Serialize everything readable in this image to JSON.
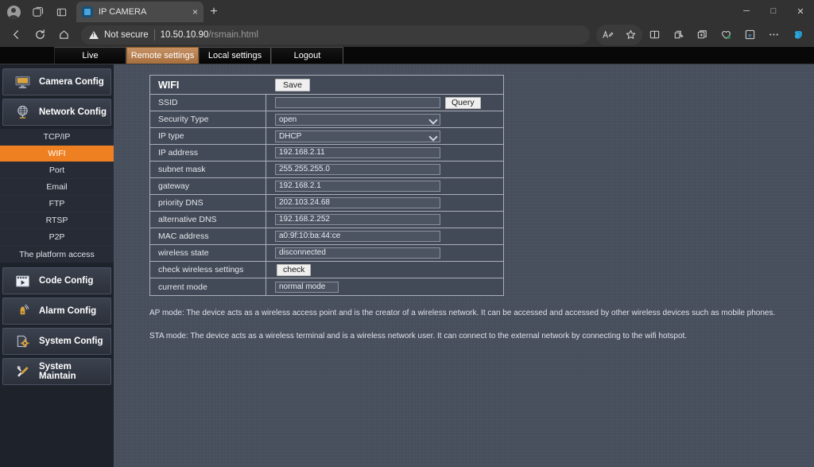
{
  "browser": {
    "tab": {
      "title": "IP CAMERA",
      "favicon": "camera-icon",
      "close": "×"
    },
    "newtab_label": "+",
    "window_controls": {
      "minimize": "─",
      "maximize": "□",
      "close": "✕"
    },
    "omnibox": {
      "security_label": "Not secure",
      "url_host": "10.50.10.90",
      "url_path": "/rsmain.html"
    },
    "toolbar_icons": [
      "read-aloud-icon",
      "favorite-star-icon",
      "split-screen-icon",
      "collections-icon",
      "tab-groups-icon",
      "browser-essentials-icon",
      "ie-mode-icon",
      "settings-more-icon",
      "copilot-icon"
    ],
    "nav_icons": [
      "back-icon",
      "refresh-icon",
      "home-icon"
    ]
  },
  "topnav": {
    "tabs": [
      {
        "label": "Live",
        "active": false
      },
      {
        "label": "Remote settings",
        "active": true
      },
      {
        "label": "Local settings",
        "active": false
      },
      {
        "label": "Logout",
        "active": false
      }
    ]
  },
  "sidebar": {
    "groups": [
      {
        "label": "Camera Config",
        "icon": "monitor-icon"
      },
      {
        "label": "Network Config",
        "icon": "globe-antenna-icon"
      }
    ],
    "sub_items": [
      {
        "label": "TCP/IP",
        "active": false
      },
      {
        "label": "WIFI",
        "active": true
      },
      {
        "label": "Port",
        "active": false
      },
      {
        "label": "Email",
        "active": false
      },
      {
        "label": "FTP",
        "active": false
      },
      {
        "label": "RTSP",
        "active": false
      },
      {
        "label": "P2P",
        "active": false
      },
      {
        "label": "The platform access",
        "active": false
      }
    ],
    "groups_lower": [
      {
        "label": "Code Config",
        "icon": "film-play-icon"
      },
      {
        "label": "Alarm Config",
        "icon": "alarm-bell-icon"
      },
      {
        "label": "System Config",
        "icon": "gear-document-icon"
      },
      {
        "label": "System Maintain",
        "icon": "wrench-screwdriver-icon"
      }
    ]
  },
  "panel": {
    "title": "WIFI",
    "save_label": "Save",
    "query_label": "Query",
    "check_label": "check",
    "rows": {
      "ssid": {
        "label": "SSID",
        "value": "",
        "placeholder": ""
      },
      "security_type": {
        "label": "Security Type",
        "value": "open"
      },
      "ip_type": {
        "label": "IP type",
        "value": "DHCP"
      },
      "ip_address": {
        "label": "IP address",
        "value": "192.168.2.11"
      },
      "subnet_mask": {
        "label": "subnet mask",
        "value": "255.255.255.0"
      },
      "gateway": {
        "label": "gateway",
        "value": "192.168.2.1"
      },
      "priority_dns": {
        "label": "priority DNS",
        "value": "202.103.24.68"
      },
      "alternative_dns": {
        "label": "alternative DNS",
        "value": "192.168.2.252"
      },
      "mac_address": {
        "label": "MAC address",
        "value": "a0:9f:10:ba:44:ce"
      },
      "wireless_state": {
        "label": "wireless state",
        "value": "disconnected"
      },
      "check_wireless": {
        "label": "check wireless settings"
      },
      "current_mode": {
        "label": "current mode",
        "value": "normal mode"
      }
    }
  },
  "help": {
    "ap_mode": "AP mode: The device acts as a wireless access point and is the creator of a wireless network. It can be accessed and accessed by other wireless devices such as mobile phones.",
    "sta_mode": "STA mode: The device acts as a wireless terminal and is a wireless network user. It can connect to the external network by connecting to the wifi hotspot."
  },
  "colors": {
    "accent": "#ef8022",
    "active_tab": "#a76f3e",
    "page_bg": "#474e5c",
    "sidebar_bg": "#1e222b"
  }
}
